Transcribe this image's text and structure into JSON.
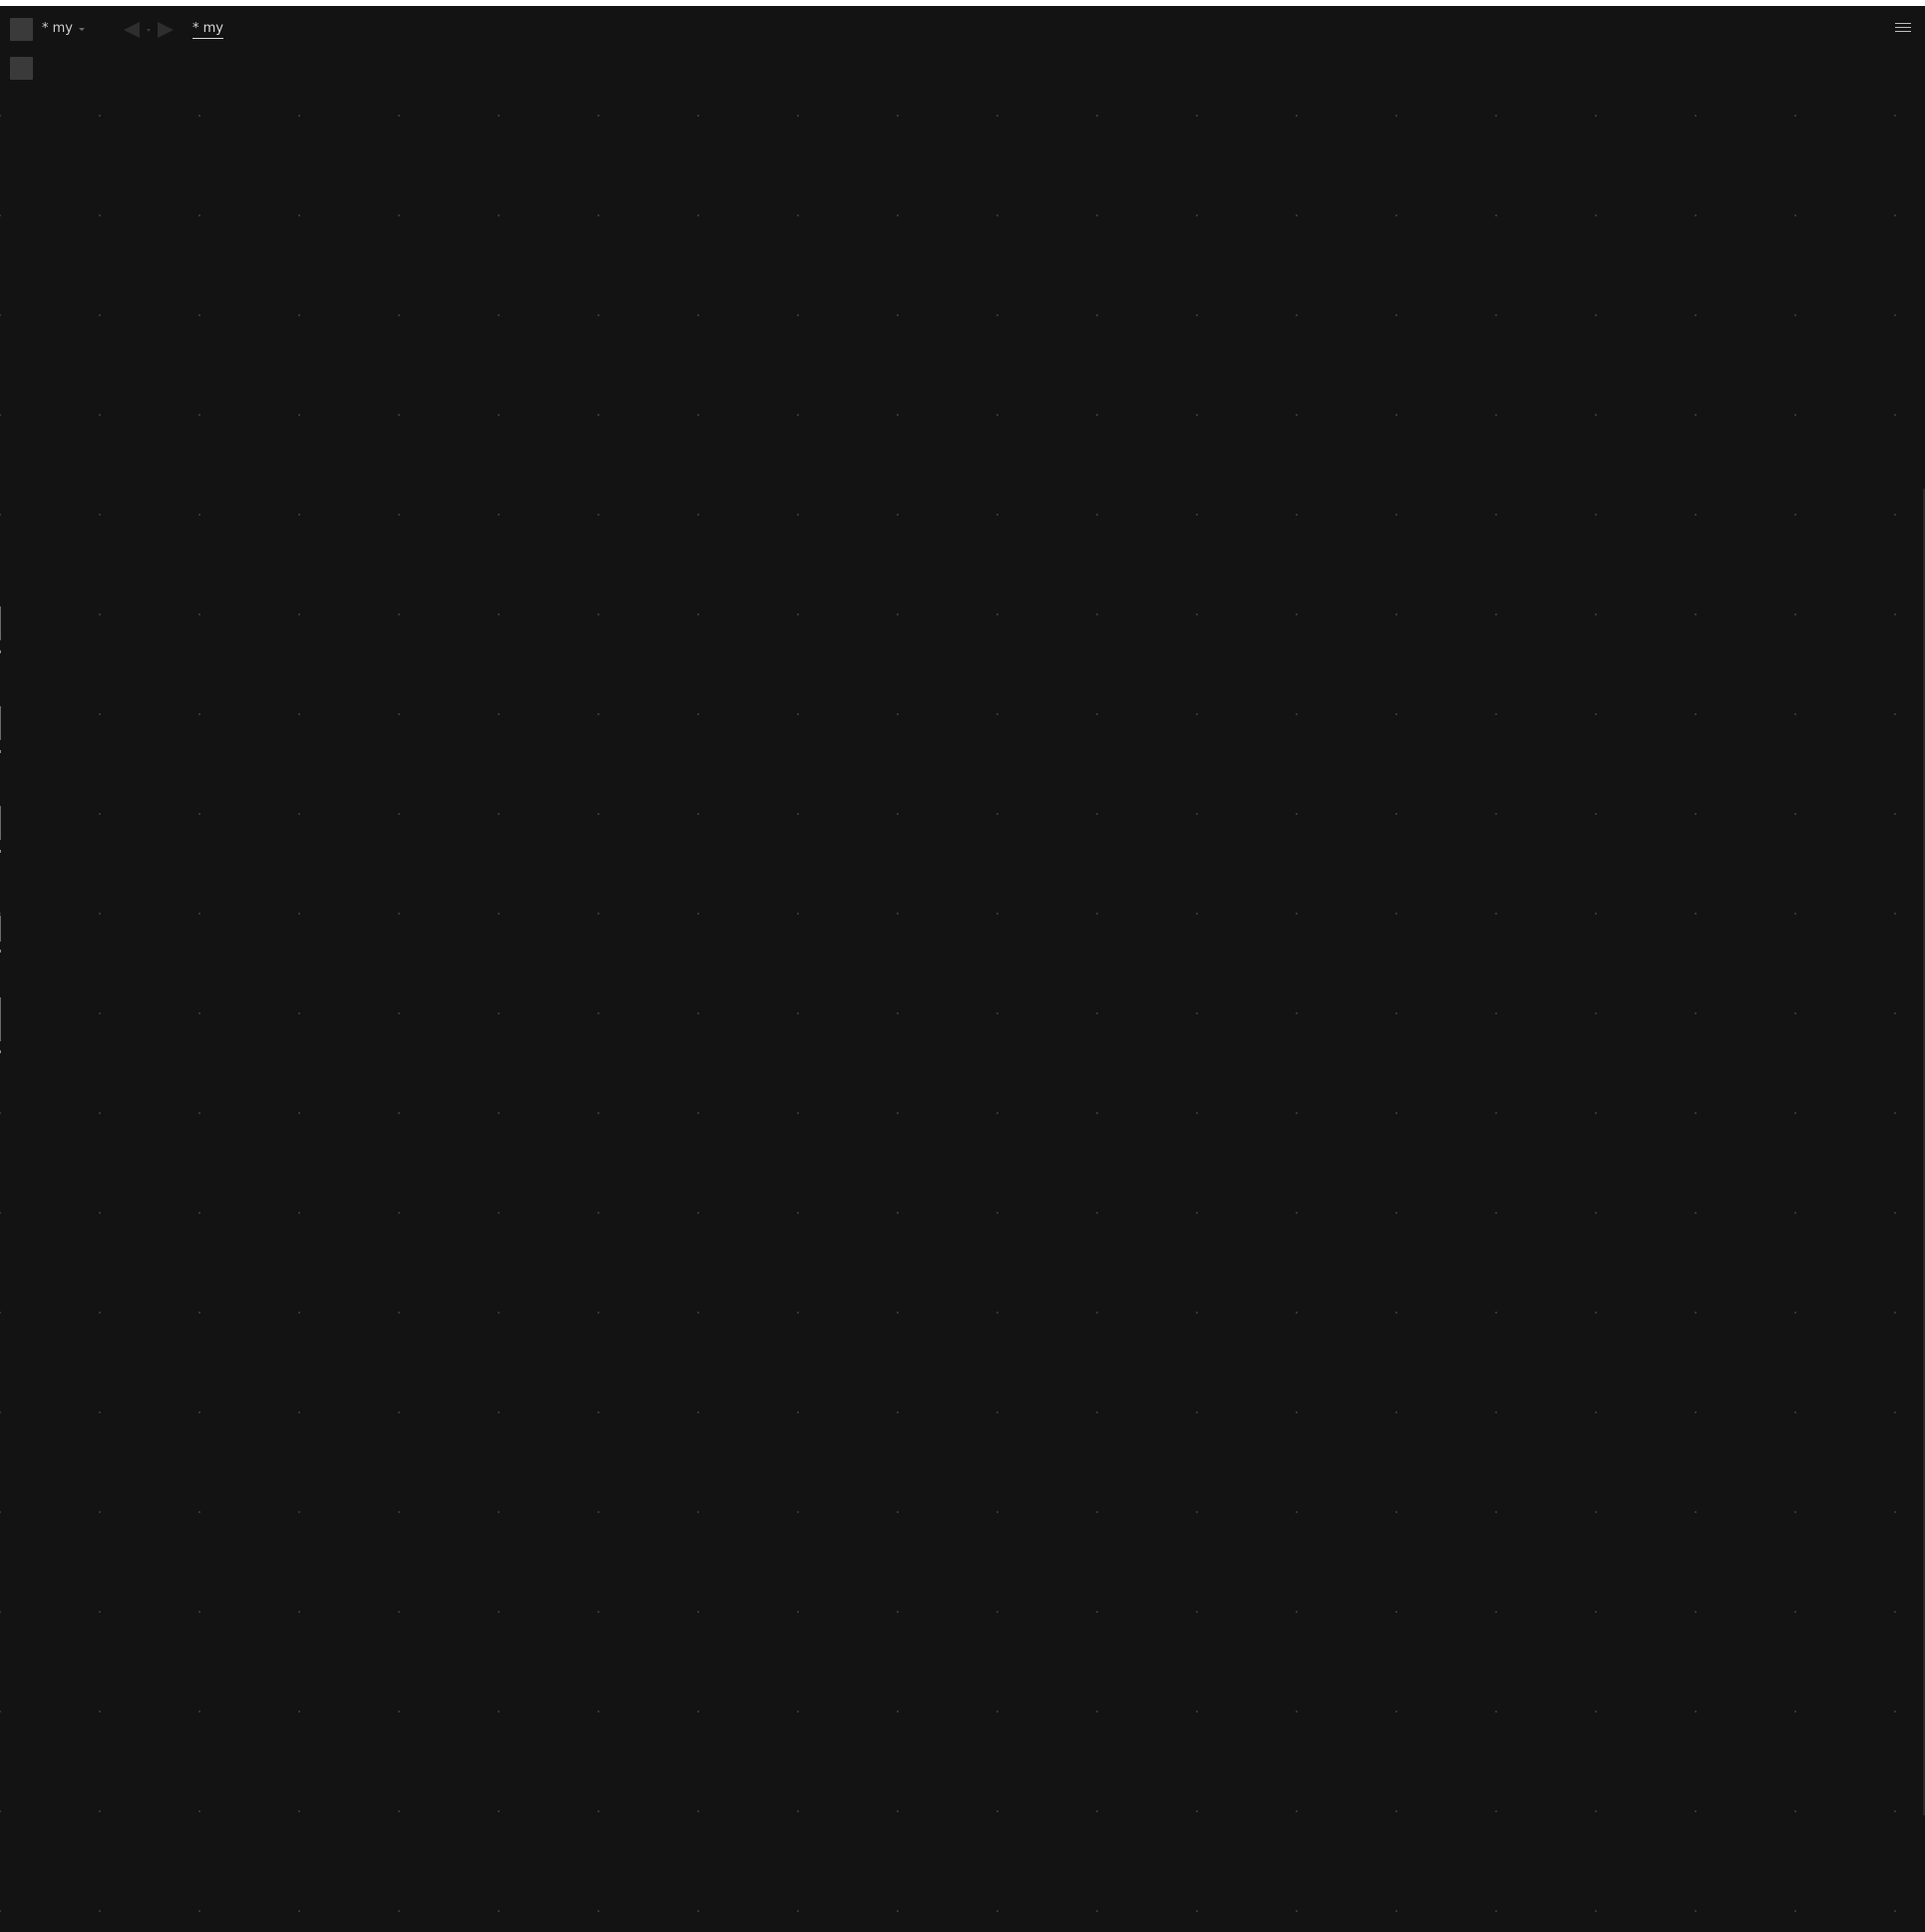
{
  "titlebar": {
    "document_label": "* my",
    "breadcrumb": "* my"
  },
  "icons": {
    "app": "app-square-icon",
    "switcher_caret": "chevron-down-icon",
    "back": "triangle-left-icon",
    "history": "chevron-down-icon",
    "forward": "triangle-right-icon",
    "menu": "hamburger-menu-icon",
    "tool": "tool-square-icon"
  },
  "colors": {
    "background": "#131313",
    "grid_dot": "#3c3c3c",
    "text": "#d8d8d8",
    "control": "#3a3a3a",
    "top_strip": "#ffffff"
  }
}
